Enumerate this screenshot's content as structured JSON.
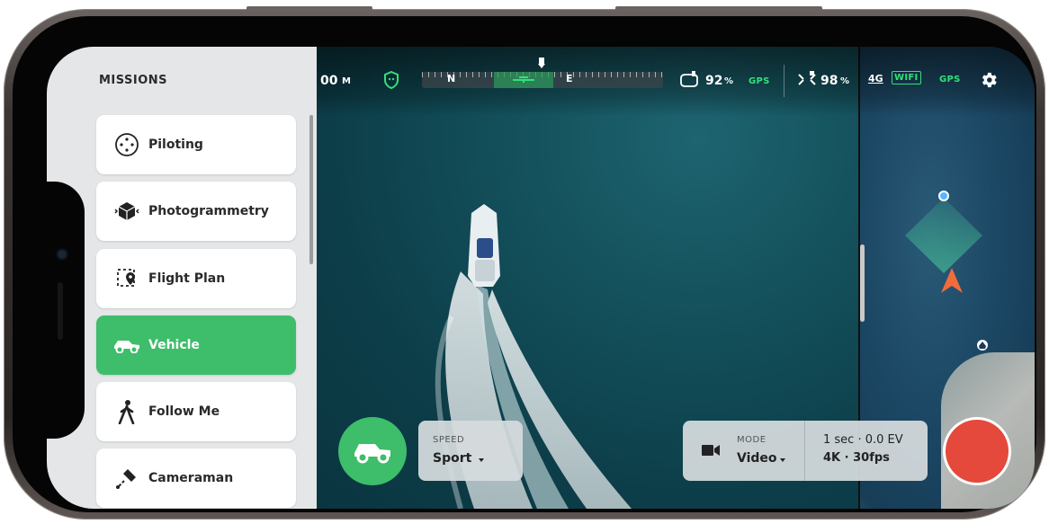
{
  "sidebar": {
    "title": "MISSIONS",
    "items": [
      {
        "label": "Piloting",
        "icon": "piloting-icon",
        "active": false
      },
      {
        "label": "Photogrammetry",
        "icon": "cube-icon",
        "active": false
      },
      {
        "label": "Flight Plan",
        "icon": "flight-plan-icon",
        "active": false
      },
      {
        "label": "Vehicle",
        "icon": "car-icon",
        "active": true
      },
      {
        "label": "Follow Me",
        "icon": "walking-person-icon",
        "active": false
      },
      {
        "label": "Cameraman",
        "icon": "cameraman-icon",
        "active": false
      }
    ]
  },
  "topbar": {
    "distance": "00",
    "distance_unit": "M",
    "compass": {
      "left": "N",
      "right": "E"
    },
    "controller_battery": "92",
    "controller_battery_unit": "%",
    "gps_label": "GPS",
    "drone_battery": "98",
    "drone_battery_unit": "%",
    "network": "4G",
    "wifi": "WIFI",
    "gps_label_2": "GPS"
  },
  "controls": {
    "speed_caption": "SPEED",
    "speed_value": "Sport",
    "mode_caption": "MODE",
    "mode_value": "Video",
    "exposure": "1 sec · 0.0 EV",
    "resolution": "4K · 30fps"
  },
  "colors": {
    "accent_green": "#3ebd6a",
    "record_red": "#e4493b",
    "gps_green": "#33e07a",
    "drone_orange": "#f26b3a"
  }
}
